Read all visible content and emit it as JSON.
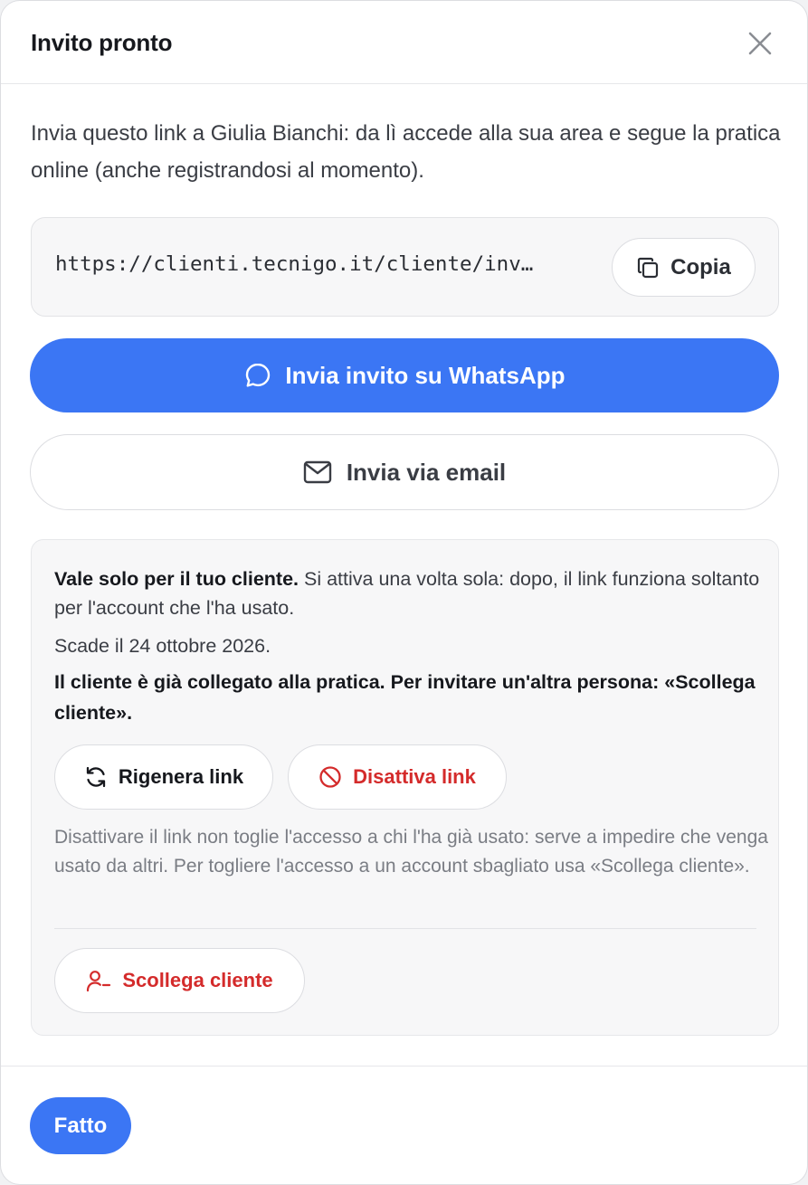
{
  "dialog": {
    "title": "Invito pronto",
    "intro": "Invia questo link a Giulia Bianchi: da lì accede alla sua area e segue la pratica online (anche registrandosi al momento).",
    "link": {
      "url": "https://clienti.tecnigo.it/cliente/inv…",
      "copy_label": "Copia"
    },
    "whatsapp_label": "Invia invito su WhatsApp",
    "email_label": "Invia via email",
    "info": {
      "strong": "Vale solo per il tuo cliente.",
      "text": " Si attiva una volta sola: dopo, il link funziona soltanto per l'account che l'ha usato.",
      "expiry": "Scade il 24 ottobre 2026.",
      "linked_warning": "Il cliente è già collegato alla pratica. Per invitare un'altra persona: «Scollega cliente».",
      "regen_label": "Rigenera link",
      "disable_label": "Disattiva link",
      "note": "Disattivare il link non toglie l'accesso a chi l'ha già usato: serve a impedire che venga usato da altri. Per togliere l'accesso a un account sbagliato usa «Scollega cliente».",
      "unlink_label": "Scollega cliente"
    },
    "done_label": "Fatto"
  },
  "colors": {
    "primary": "#3b76f4",
    "danger": "#d42b2b",
    "muted": "#7a7d84"
  },
  "icons": {
    "close": "close-icon",
    "copy": "copy-icon",
    "whatsapp": "chat-bubble-icon",
    "email": "mail-icon",
    "regen": "refresh-icon",
    "disable": "ban-icon",
    "unlink": "user-minus-icon"
  }
}
